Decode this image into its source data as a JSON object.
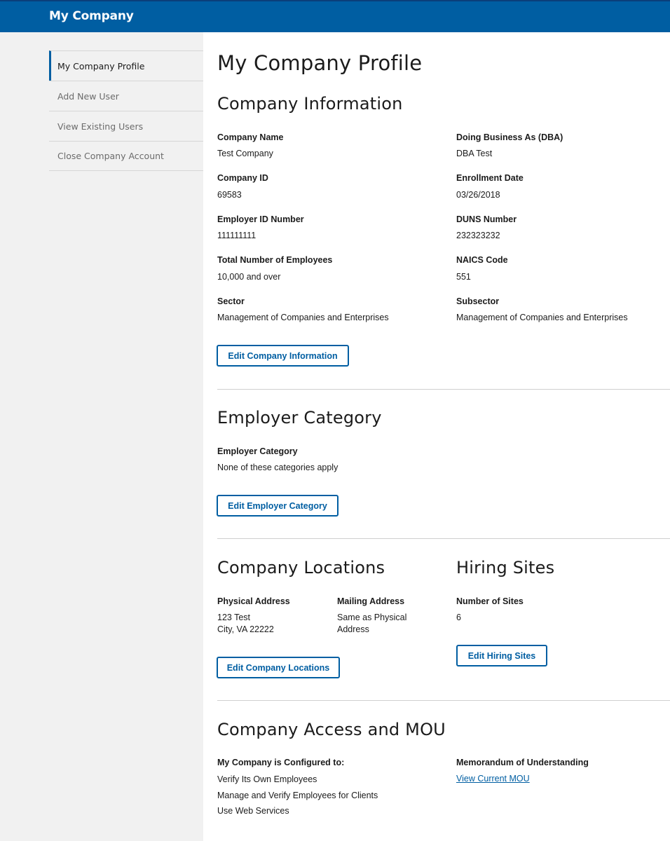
{
  "header": {
    "title": "My Company"
  },
  "sidebar": {
    "items": [
      {
        "label": "My Company Profile"
      },
      {
        "label": "Add New User"
      },
      {
        "label": "View Existing Users"
      },
      {
        "label": "Close Company Account"
      }
    ]
  },
  "page": {
    "title": "My Company Profile"
  },
  "company_info": {
    "heading": "Company Information",
    "fields": {
      "company_name": {
        "label": "Company Name",
        "value": "Test Company"
      },
      "dba": {
        "label": "Doing Business As (DBA)",
        "value": "DBA Test"
      },
      "company_id": {
        "label": "Company ID",
        "value": "69583"
      },
      "enrollment_date": {
        "label": "Enrollment Date",
        "value": "03/26/2018"
      },
      "ein": {
        "label": "Employer ID Number",
        "value": "111111111"
      },
      "duns": {
        "label": "DUNS Number",
        "value": "232323232"
      },
      "total_employees": {
        "label": "Total Number of Employees",
        "value": "10,000 and over"
      },
      "naics": {
        "label": "NAICS Code",
        "value": "551"
      },
      "sector": {
        "label": "Sector",
        "value": "Management of Companies and Enterprises"
      },
      "subsector": {
        "label": "Subsector",
        "value": "Management of Companies and Enterprises"
      }
    },
    "edit_button": "Edit Company Information"
  },
  "employer_category": {
    "heading": "Employer Category",
    "label": "Employer Category",
    "value": "None of these categories apply",
    "edit_button": "Edit Employer Category"
  },
  "locations": {
    "heading": "Company Locations",
    "physical_label": "Physical Address",
    "physical_line1": "123 Test",
    "physical_line2": "City, VA 22222",
    "mailing_label": "Mailing Address",
    "mailing_line1": "Same as Physical",
    "mailing_line2": "Address",
    "edit_button": "Edit Company Locations"
  },
  "hiring_sites": {
    "heading": "Hiring Sites",
    "label": "Number of Sites",
    "value": "6",
    "edit_button": "Edit Hiring Sites"
  },
  "access": {
    "heading": "Company Access and MOU",
    "configured_label": "My Company is Configured to:",
    "configured_items": [
      "Verify Its Own Employees",
      "Manage and Verify Employees for Clients",
      "Use Web Services"
    ],
    "mou_label": "Memorandum of Understanding",
    "mou_link": "View Current MOU"
  },
  "colors": {
    "primary": "#005ea2",
    "header_bg": "#005ea2",
    "page_bg": "#f1f1f1"
  }
}
